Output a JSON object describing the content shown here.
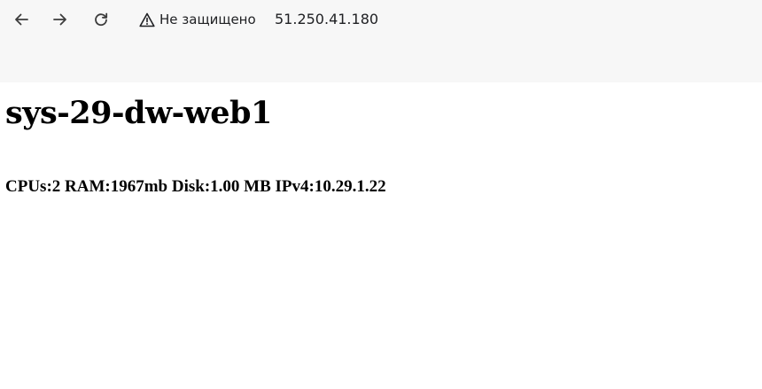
{
  "browser": {
    "security_text": "Не защищено",
    "url": "51.250.41.180",
    "icons": {
      "back": "arrow-left-icon",
      "forward": "arrow-right-icon",
      "reload": "reload-icon",
      "security": "warning-triangle-icon"
    }
  },
  "page": {
    "title": "sys-29-dw-web1",
    "info": "CPUs:2 RAM:1967mb Disk:1.00 MB IPv4:10.29.1.22"
  }
}
